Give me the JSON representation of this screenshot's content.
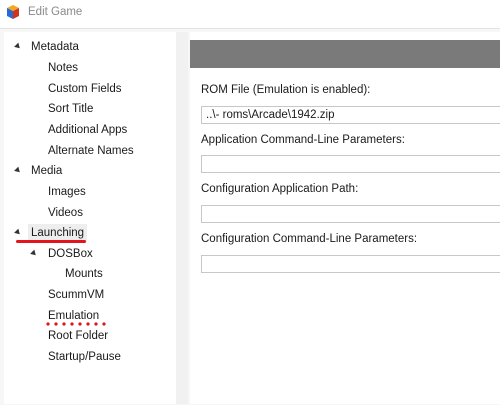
{
  "window": {
    "title": "Edit Game",
    "icon": "app-cube-icon"
  },
  "tree": {
    "metadata": {
      "label": "Metadata",
      "children": [
        "Notes",
        "Custom Fields",
        "Sort Title",
        "Additional Apps",
        "Alternate Names"
      ]
    },
    "media": {
      "label": "Media",
      "children": [
        "Images",
        "Videos"
      ]
    },
    "launching": {
      "label": "Launching",
      "dosbox": {
        "label": "DOSBox",
        "children": [
          "Mounts"
        ]
      },
      "children": [
        "ScummVM",
        "Emulation",
        "Root Folder",
        "Startup/Pause"
      ]
    }
  },
  "form": {
    "rom_file": {
      "label": "ROM File (Emulation is enabled):",
      "value": "..\\- roms\\Arcade\\1942.zip"
    },
    "app_cmdline": {
      "label": "Application Command-Line Parameters:",
      "value": ""
    },
    "config_path": {
      "label": "Configuration Application Path:",
      "value": ""
    },
    "config_cmdline": {
      "label": "Configuration Command-Line Parameters:",
      "value": ""
    }
  },
  "colors": {
    "annotation": "#e3141b",
    "header_band": "#7a7a7a"
  }
}
